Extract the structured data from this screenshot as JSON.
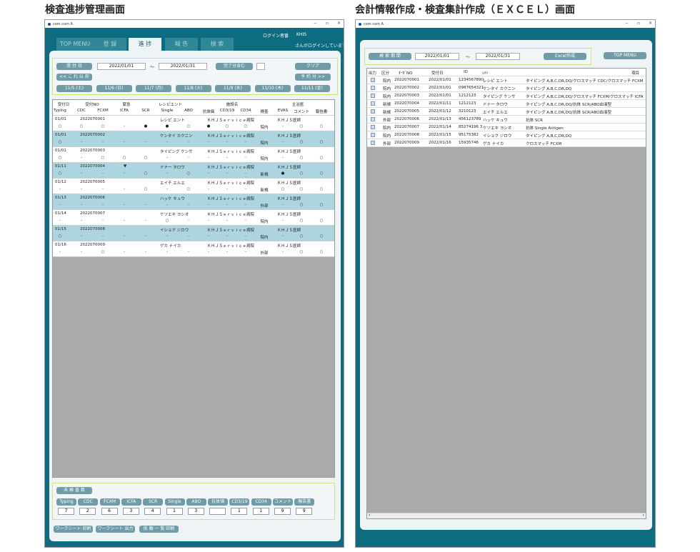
{
  "headings": {
    "left": "検査進捗管理画面",
    "right": "会計情報作成・検査集計作成（ＥＸＣＥＬ）画面"
  },
  "window_title": "com com A",
  "tabs": [
    "TOP MENU",
    "登 録",
    "進 捗",
    "報 告",
    "検 索"
  ],
  "login": {
    "label": "ログイン者番",
    "user": "KHIS",
    "message": "さんがログインしています。"
  },
  "filter": {
    "date_label": "受 付 日",
    "from": "2022/01/01",
    "tilde": "～",
    "to": "2022/01/31",
    "complete_label": "完了分含む",
    "clear": "クリア",
    "prev": "<< こ れ 以 前",
    "next": "予 約 分 >>",
    "days": [
      "11/5 (土)",
      "11/6 (日)",
      "11/7 (月)",
      "11/8 (火)",
      "11/9 (水)",
      "11/10 (木)",
      "11/11 (金)"
    ]
  },
  "grid_header": {
    "r1": [
      "受付日",
      "受付NO",
      "緊急",
      "レシピエント",
      "施設名",
      "主治医"
    ],
    "r2": [
      "Typing",
      "CDC",
      "FCXM",
      "ICFA",
      "SCR",
      "Single",
      "ABO",
      "抗体価",
      "CD3/19",
      "CD34",
      "検査",
      "EVAS",
      "コメント",
      "報告書"
    ]
  },
  "records": [
    {
      "date": "01/01",
      "no": "2022070001",
      "urgent": "",
      "name": "レシピ エント",
      "facility": "ＫＨＪＳｅｒｖｉｃｅ病院",
      "doctor": "ＫＨＪＳ医師",
      "marks": [
        "○",
        "○",
        "○",
        "-",
        "●",
        "●",
        "○",
        "●",
        "○",
        "○",
        "院内",
        "-",
        "○",
        "○"
      ],
      "hl": false
    },
    {
      "date": "01/01",
      "no": "2022070002",
      "urgent": "",
      "name": "ケンタイ カクニン",
      "facility": "ＫＨＪＳｅｒｖｉｃｅ病院",
      "doctor": "ＫＨＪＳ医師",
      "marks": [
        "○",
        "-",
        "-",
        "-",
        "-",
        "-",
        "-",
        "-",
        "-",
        "-",
        "院内",
        "-",
        "○",
        "○"
      ],
      "hl": true
    },
    {
      "date": "01/01",
      "no": "2022070003",
      "urgent": "",
      "name": "タイピング ケンサ",
      "facility": "ＫＨＪＳｅｒｖｉｃｅ病院",
      "doctor": "ＫＨＪＳ医師",
      "marks": [
        "○",
        "-",
        "○",
        "○",
        "○",
        "-",
        "-",
        "-",
        "-",
        "-",
        "院内",
        "-",
        "○",
        "○"
      ],
      "hl": false
    },
    {
      "date": "01/11",
      "no": "2022070004",
      "urgent": "▼",
      "name": "ドナー タロウ",
      "facility": "ＫＨＪＳｅｒｖｉｃｅ病院",
      "doctor": "ＫＨＪＳ医師",
      "marks": [
        "○",
        "-",
        "-",
        "-",
        "○",
        "-",
        "○",
        "-",
        "-",
        "-",
        "新規",
        "●",
        "○",
        "○"
      ],
      "hl": true
    },
    {
      "date": "01/12",
      "no": "2022070005",
      "urgent": "",
      "name": "エイチ エルエ",
      "facility": "ＫＨＪＳｅｒｖｉｃｅ病院",
      "doctor": "ＫＨＪＳ医師",
      "marks": [
        "-",
        "-",
        "-",
        "-",
        "○",
        "-",
        "○",
        "-",
        "-",
        "-",
        "新規",
        "○",
        "○",
        "○"
      ],
      "hl": false
    },
    {
      "date": "01/13",
      "no": "2022070006",
      "urgent": "",
      "name": "ハッケ キュウ",
      "facility": "ＫＨＪＳｅｒｖｉｃｅ病院",
      "doctor": "ＫＨＪＳ医師",
      "marks": [
        "-",
        "-",
        "-",
        "-",
        "-",
        "-",
        "-",
        "-",
        "-",
        "-",
        "外部",
        "-",
        "○",
        "○"
      ],
      "hl": true
    },
    {
      "date": "01/14",
      "no": "2022070007",
      "urgent": "",
      "name": "ケツエキ ヨシオ",
      "facility": "ＫＨＪＳｅｒｖｉｃｅ病院",
      "doctor": "ＫＨＪＳ医師",
      "marks": [
        "-",
        "-",
        "-",
        "-",
        "-",
        "○",
        "-",
        "-",
        "-",
        "-",
        "院内",
        "-",
        "○",
        "○"
      ],
      "hl": false
    },
    {
      "date": "01/15",
      "no": "2022070008",
      "urgent": "",
      "name": "イショク ジロウ",
      "facility": "ＫＨＪＳｅｒｖｉｃｅ病院",
      "doctor": "ＫＨＪＳ医師",
      "marks": [
        "○",
        "-",
        "-",
        "-",
        "-",
        "-",
        "-",
        "-",
        "-",
        "-",
        "院内",
        "-",
        "○",
        "○"
      ],
      "hl": true
    },
    {
      "date": "01/16",
      "no": "2022070009",
      "urgent": "",
      "name": "ゲカ ナイカ",
      "facility": "ＫＨＪＳｅｒｖｉｃｅ病院",
      "doctor": "ＫＨＪＳ医師",
      "marks": [
        "-",
        "-",
        "○",
        "-",
        "-",
        "-",
        "-",
        "-",
        "-",
        "-",
        "外部",
        "-",
        "○",
        "○"
      ],
      "hl": false
    }
  ],
  "pending": {
    "label": "未 検 査 数",
    "items": [
      "Typing",
      "CDC",
      "FCXM",
      "ICFA",
      "SCR",
      "Single",
      "ABO",
      "抗体価",
      "CD3/19",
      "CD34",
      "コメント",
      "報告書"
    ],
    "counts": [
      "7",
      "2",
      "6",
      "3",
      "4",
      "1",
      "3",
      "",
      "1",
      "1",
      "9",
      "9"
    ]
  },
  "bottom_buttons": [
    "ワークシート 印刷",
    "ワークシート 出力",
    "依 頼 一 覧 印刷"
  ],
  "right": {
    "period_label": "検 索 期 間",
    "from": "2022/01/01",
    "tilde": "～",
    "to": "2022/01/31",
    "excel": "Excel作成",
    "top": "TOP MENU",
    "cols": [
      "出力",
      "区分",
      "ｵｰﾀﾞNO",
      "受付日",
      "ID",
      "ｼﾒｲ",
      "項目"
    ],
    "rows": [
      [
        "院内",
        "2022070001",
        "2022/01/01",
        "1234567890",
        "レシピ エント",
        "タイピング A,B,C,DR,DQ/クロスマッチ CDC/クロスマッチ FCXM"
      ],
      [
        "院内",
        "2022070002",
        "2022/01/01",
        "0987654321",
        "ケンタイ カクニン",
        "タイピング A,B,C,DR,DQ"
      ],
      [
        "院内",
        "2022070003",
        "2022/01/01",
        "1212123",
        "タイピング ケンサ",
        "タイピング A,B,C,DR,DQ/クロスマッチ FCXM/クロスマッチ ICFA"
      ],
      [
        "新規",
        "2022070004",
        "2022/01/11",
        "1212123",
        "ドナー タロウ",
        "タイピング A,B,C,DR,DQ/抗体 SCR/ABO血液型"
      ],
      [
        "新規",
        "2022070005",
        "2022/01/12",
        "3210123",
        "エイチ エルエ",
        "タイピング A,B,C,DR,DQ/抗体 SCR/ABO血液型"
      ],
      [
        "外部",
        "2022070006",
        "2022/01/13",
        "456123789",
        "ハッケ キュウ",
        "抗体 SCR"
      ],
      [
        "院内",
        "2022070007",
        "2022/01/14",
        "85274196 3",
        "ケツエキ ヨシオ",
        "抗体 Single Antigen"
      ],
      [
        "院内",
        "2022070008",
        "2022/01/15",
        "95175382",
        "イショク ジロウ",
        "タイピング A,B,C,DR,DQ"
      ],
      [
        "外部",
        "2022070009",
        "2022/01/16",
        "15935746",
        "ゲカ ナイカ",
        "クロスマッチ FCXM"
      ]
    ]
  }
}
